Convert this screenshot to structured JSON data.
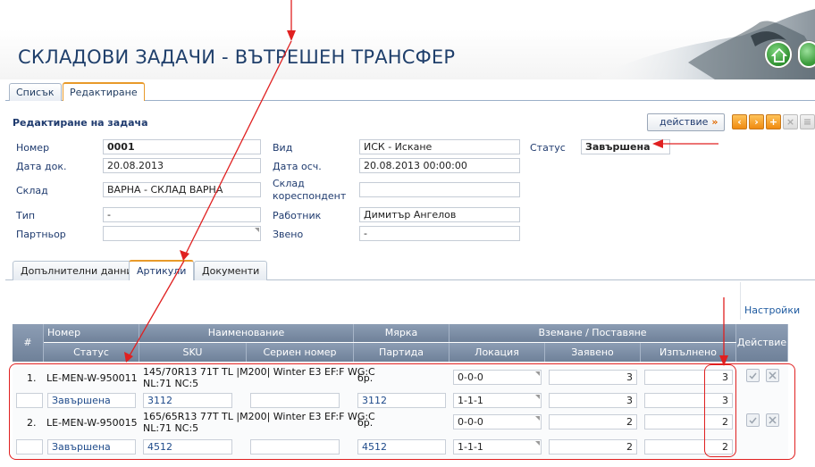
{
  "header": {
    "title": "СКЛАДОВИ ЗАДАЧИ - ВЪТРЕШЕН ТРАНСФЕР"
  },
  "tabs": [
    {
      "label": "Списък"
    },
    {
      "label": "Редактиране",
      "active": true
    }
  ],
  "form": {
    "title": "Редактиране на задача",
    "action_label": "действие",
    "fields": {
      "number": {
        "label": "Номер",
        "value": "0001"
      },
      "doc_date": {
        "label": "Дата док.",
        "value": "20.08.2013"
      },
      "warehouse": {
        "label": "Склад",
        "value": "ВАРНА - СКЛАД ВАРНА"
      },
      "type": {
        "label": "Тип",
        "value": "-"
      },
      "partner": {
        "label": "Партньор",
        "value": ""
      },
      "kind": {
        "label": "Вид",
        "value": "ИСК - Искане"
      },
      "exec_date": {
        "label": "Дата осч.",
        "value": "20.08.2013 00:00:00"
      },
      "corr_warehouse": {
        "label_line1": "Склад",
        "label_line2": "кореспондент",
        "value": ""
      },
      "worker": {
        "label": "Работник",
        "value": "Димитър Ангелов"
      },
      "unit": {
        "label": "Звено",
        "value": "-"
      },
      "status": {
        "label": "Статус",
        "value": "Завършена"
      }
    }
  },
  "subtabs": [
    {
      "label": "Допълнителни данни"
    },
    {
      "label": "Артикули",
      "active": true
    },
    {
      "label": "Документи"
    }
  ],
  "settings_label": "Настройки",
  "grid": {
    "headers": {
      "idx": "#",
      "number": "Номер",
      "status": "Статус",
      "name": "Наименование",
      "sku": "SKU",
      "serial": "Сериен номер",
      "measure": "Мярка",
      "batch": "Партида",
      "pick": "Вземане / Поставяне",
      "location": "Локация",
      "requested": "Заявено",
      "done": "Изпълнено",
      "action": "Действие"
    },
    "rows": [
      {
        "idx": "1.",
        "number": "LE-MEN-W-950011",
        "name_line1": "145/70R13 71T TL |M200| Winter E3 EF:F WG:C",
        "name_line2": "NL:71 NC:5",
        "measure": "бр.",
        "loc1": "0-0-0",
        "req1": "3",
        "done1": "3",
        "status": "Завършена",
        "sku": "3112",
        "serial": "",
        "batch": "3112",
        "loc2": "1-1-1",
        "req2": "3",
        "done2": "3"
      },
      {
        "idx": "2.",
        "number": "LE-MEN-W-950015",
        "name_line1": "165/65R13 77T TL |M200| Winter E3 EF:F WG:C",
        "name_line2": "NL:71 NC:5",
        "measure": "бр.",
        "loc1": "0-0-0",
        "req1": "2",
        "done1": "2",
        "status": "Завършена",
        "sku": "4512",
        "serial": "",
        "batch": "4512",
        "loc2": "1-1-1",
        "req2": "2",
        "done2": "2"
      }
    ]
  },
  "colors": {
    "annotation": "#e02020",
    "accent": "#e89a2a",
    "header_text": "#1f3f6b",
    "grid_header": "#7b8ca3"
  }
}
